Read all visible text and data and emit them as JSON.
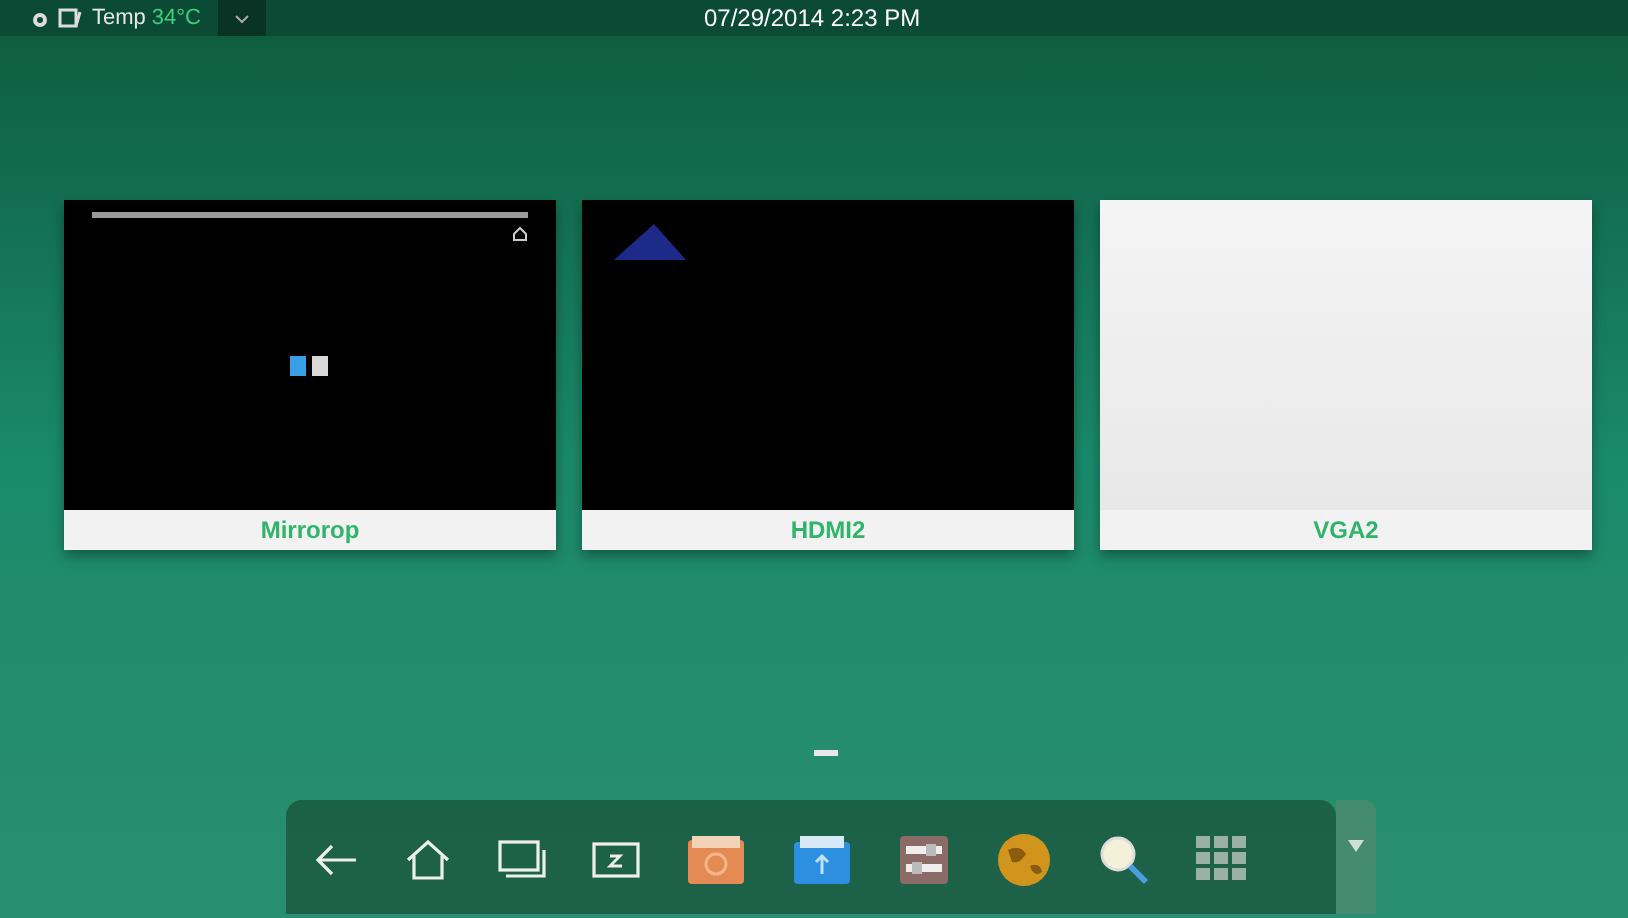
{
  "status_bar": {
    "temp_label": "Temp",
    "temp_value": "34°C",
    "datetime": "07/29/2014 2:23 PM"
  },
  "sources": [
    {
      "label": "Mirrorop",
      "kind": "android"
    },
    {
      "label": "HDMI2",
      "kind": "bios"
    },
    {
      "label": "VGA2",
      "kind": "blank"
    }
  ]
}
